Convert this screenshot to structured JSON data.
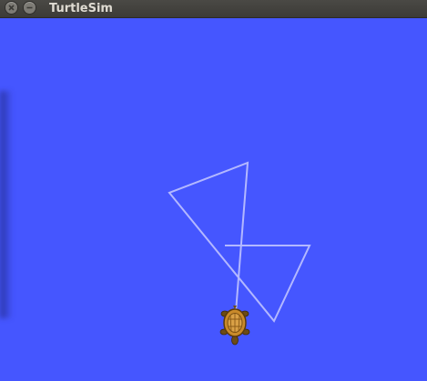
{
  "window": {
    "title": "TurtleSim",
    "close_icon": "close-icon",
    "minimize_icon": "minimize-icon"
  },
  "canvas": {
    "background_color": "#4556ff",
    "pen_color": "#b3b8ff",
    "turtle_icon": "turtle-icon"
  }
}
